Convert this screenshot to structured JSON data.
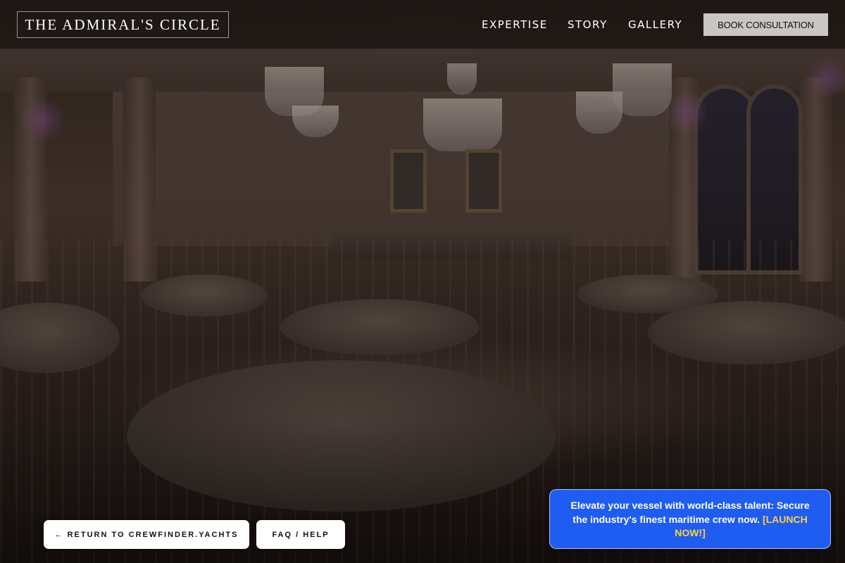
{
  "navbar": {
    "brand": "THE ADMIRAL'S CIRCLE",
    "links": [
      "EXPERTISE",
      "STORY",
      "GALLERY"
    ],
    "cta_label": "BOOK CONSULTATION"
  },
  "footer_buttons": {
    "return_label": "← RETURN TO CREWFINDER.YACHTS",
    "faq_label": "FAQ / HELP"
  },
  "promo": {
    "text": "Elevate your vessel with world-class talent: Secure the industry's finest maritime crew now.",
    "link_label": "[LAUNCH NOW!]",
    "background_color": "#1f5cf2",
    "link_color": "#ffd23a"
  },
  "hero": {
    "background_image_icon": "ballroom-photo"
  }
}
